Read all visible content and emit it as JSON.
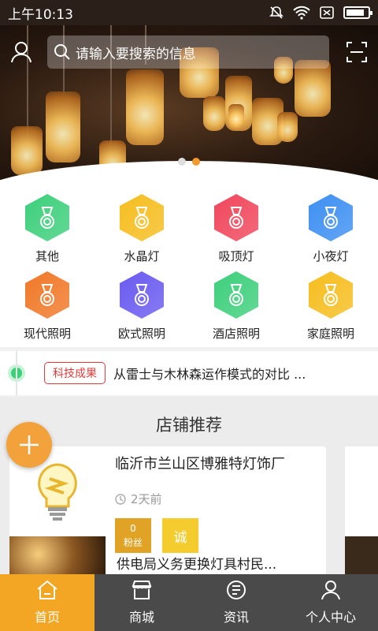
{
  "status_bar": {
    "time": "上午10:13"
  },
  "search": {
    "placeholder": "请输入要搜索的信息"
  },
  "banner": {
    "dots": 2,
    "active_dot": 2
  },
  "categories": [
    {
      "label": "其他",
      "color": "#3dcf7b"
    },
    {
      "label": "水晶灯",
      "color": "#f6bd1e"
    },
    {
      "label": "吸顶灯",
      "color": "#f0465b"
    },
    {
      "label": "小夜灯",
      "color": "#3d8ff2"
    },
    {
      "label": "现代照明",
      "color": "#f07827"
    },
    {
      "label": "欧式照明",
      "color": "#6a5af0"
    },
    {
      "label": "酒店照明",
      "color": "#3dcf7b"
    },
    {
      "label": "家庭照明",
      "color": "#f6bd1e"
    }
  ],
  "news": {
    "tag": "科技成果",
    "text": "从雷士与木林森运作模式的对比 ..."
  },
  "section": {
    "title": "店铺推荐"
  },
  "shop": {
    "name": "临沂市兰山区博雅特灯饰厂",
    "time": "2天前",
    "fans_count": "0",
    "fans_label": "粉丝",
    "cert_label": "诚",
    "next_title": "供电局义务更换灯具村民..."
  },
  "tabs": [
    {
      "label": "首页",
      "icon": "home-icon",
      "active": true
    },
    {
      "label": "商城",
      "icon": "shop-icon",
      "active": false
    },
    {
      "label": "资讯",
      "icon": "news-icon",
      "active": false
    },
    {
      "label": "个人中心",
      "icon": "user-icon",
      "active": false
    }
  ]
}
